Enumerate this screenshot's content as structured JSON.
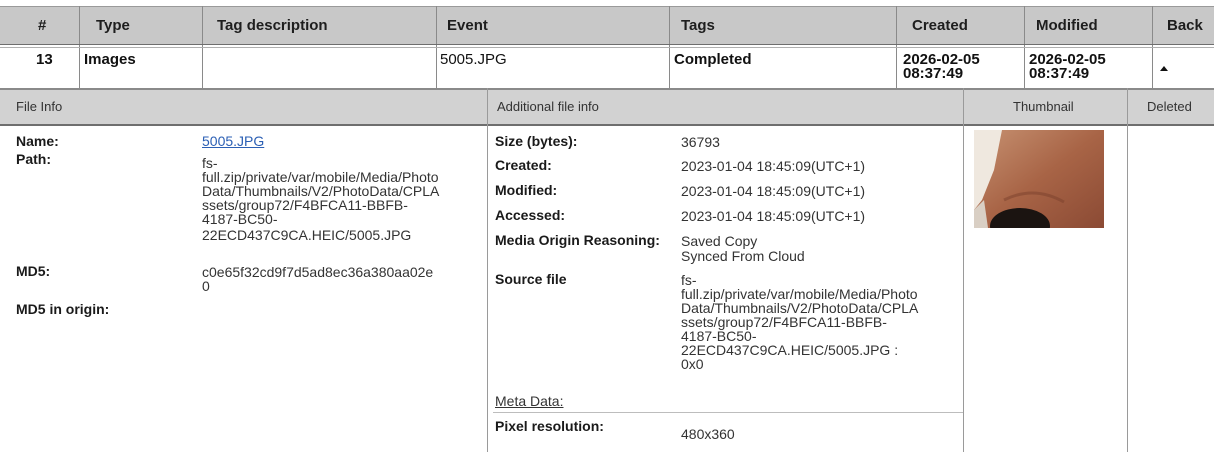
{
  "header": {
    "num": "#",
    "type": "Type",
    "tag_description": "Tag description",
    "event": "Event",
    "tags": "Tags",
    "created": "Created",
    "modified": "Modified",
    "back": "Back"
  },
  "row": {
    "num": "13",
    "type": "Images",
    "tag_description": "",
    "event": "5005.JPG",
    "tags": "Completed",
    "created_date": "2026-02-05",
    "created_time": "08:37:49",
    "modified_date": "2026-02-05",
    "modified_time": "08:37:49"
  },
  "subheader": {
    "file_info": "File Info",
    "additional": "Additional file info",
    "thumbnail": "Thumbnail",
    "deleted": "Deleted"
  },
  "file_info": {
    "name_label": "Name:",
    "name_value": "5005.JPG",
    "path_label": "Path:",
    "path_lines": [
      "fs-",
      "full.zip/private/var/mobile/Media/Photo",
      "Data/Thumbnails/V2/PhotoData/CPLA",
      "ssets/group72/F4BFCA11-BBFB-",
      "4187-BC50-",
      "22ECD437C9CA.HEIC/5005.JPG"
    ],
    "md5_label": "MD5:",
    "md5_lines": [
      "c0e65f32cd9f7d5ad8ec36a380aa02e",
      "0"
    ],
    "md5_origin_label": "MD5 in origin:"
  },
  "additional": {
    "size_label": "Size (bytes):",
    "size_value": "36793",
    "created_label": "Created:",
    "created_value": "2023-01-04 18:45:09(UTC+1)",
    "modified_label": "Modified:",
    "modified_value": "2023-01-04 18:45:09(UTC+1)",
    "accessed_label": "Accessed:",
    "accessed_value": "2023-01-04 18:45:09(UTC+1)",
    "origin_label": "Media Origin Reasoning:",
    "origin_lines": [
      "Saved Copy",
      "Synced From Cloud"
    ],
    "source_label": "Source file",
    "source_lines": [
      "fs-",
      "full.zip/private/var/mobile/Media/Photo",
      "Data/Thumbnails/V2/PhotoData/CPLA",
      "ssets/group72/F4BFCA11-BBFB-",
      "4187-BC50-",
      "22ECD437C9CA.HEIC/5005.JPG :",
      "0x0"
    ],
    "meta_label": "Meta Data:",
    "pixel_label": "Pixel resolution:",
    "pixel_value": "480x360"
  }
}
